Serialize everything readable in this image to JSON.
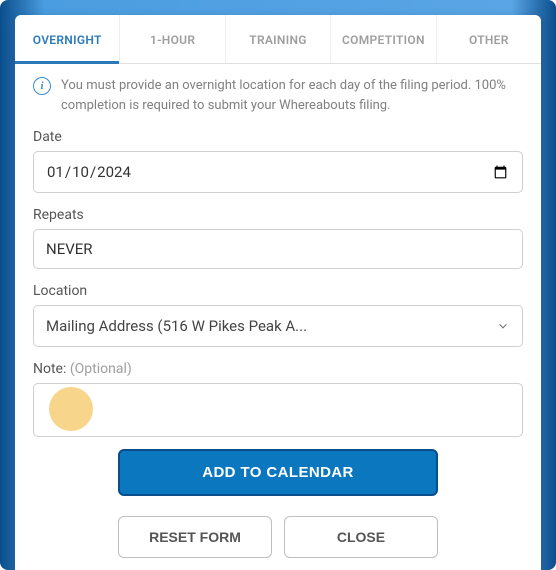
{
  "tabs": {
    "overnight": "OVERNIGHT",
    "onehour": "1-HOUR",
    "training": "TRAINING",
    "competition": "COMPETITION",
    "other": "OTHER"
  },
  "info_text": "You must provide an overnight location for each day of the filing period. 100% completion is required to submit your Whereabouts filing.",
  "fields": {
    "date_label": "Date",
    "date_value": "2024-01-10",
    "repeats_label": "Repeats",
    "repeats_value": "NEVER",
    "location_label": "Location",
    "location_value": "Mailing Address (516 W Pikes Peak A...",
    "note_label": "Note:",
    "note_optional": " (Optional)",
    "note_value": ""
  },
  "buttons": {
    "add": "ADD TO CALENDAR",
    "reset": "RESET FORM",
    "close": "CLOSE"
  }
}
